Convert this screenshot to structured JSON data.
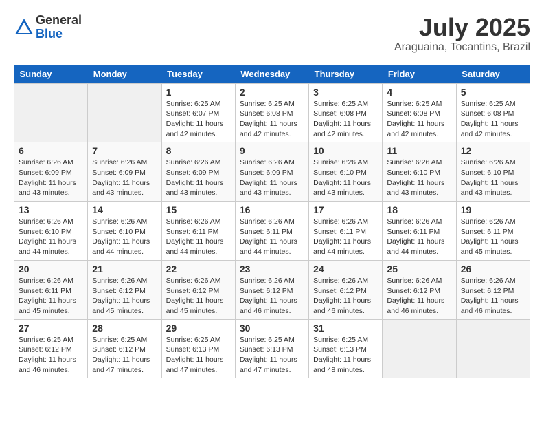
{
  "logo": {
    "general": "General",
    "blue": "Blue"
  },
  "title": {
    "month": "July 2025",
    "location": "Araguaina, Tocantins, Brazil"
  },
  "weekdays": [
    "Sunday",
    "Monday",
    "Tuesday",
    "Wednesday",
    "Thursday",
    "Friday",
    "Saturday"
  ],
  "weeks": [
    [
      {
        "day": "",
        "info": ""
      },
      {
        "day": "",
        "info": ""
      },
      {
        "day": "1",
        "info": "Sunrise: 6:25 AM\nSunset: 6:07 PM\nDaylight: 11 hours and 42 minutes."
      },
      {
        "day": "2",
        "info": "Sunrise: 6:25 AM\nSunset: 6:08 PM\nDaylight: 11 hours and 42 minutes."
      },
      {
        "day": "3",
        "info": "Sunrise: 6:25 AM\nSunset: 6:08 PM\nDaylight: 11 hours and 42 minutes."
      },
      {
        "day": "4",
        "info": "Sunrise: 6:25 AM\nSunset: 6:08 PM\nDaylight: 11 hours and 42 minutes."
      },
      {
        "day": "5",
        "info": "Sunrise: 6:25 AM\nSunset: 6:08 PM\nDaylight: 11 hours and 42 minutes."
      }
    ],
    [
      {
        "day": "6",
        "info": "Sunrise: 6:26 AM\nSunset: 6:09 PM\nDaylight: 11 hours and 43 minutes."
      },
      {
        "day": "7",
        "info": "Sunrise: 6:26 AM\nSunset: 6:09 PM\nDaylight: 11 hours and 43 minutes."
      },
      {
        "day": "8",
        "info": "Sunrise: 6:26 AM\nSunset: 6:09 PM\nDaylight: 11 hours and 43 minutes."
      },
      {
        "day": "9",
        "info": "Sunrise: 6:26 AM\nSunset: 6:09 PM\nDaylight: 11 hours and 43 minutes."
      },
      {
        "day": "10",
        "info": "Sunrise: 6:26 AM\nSunset: 6:10 PM\nDaylight: 11 hours and 43 minutes."
      },
      {
        "day": "11",
        "info": "Sunrise: 6:26 AM\nSunset: 6:10 PM\nDaylight: 11 hours and 43 minutes."
      },
      {
        "day": "12",
        "info": "Sunrise: 6:26 AM\nSunset: 6:10 PM\nDaylight: 11 hours and 43 minutes."
      }
    ],
    [
      {
        "day": "13",
        "info": "Sunrise: 6:26 AM\nSunset: 6:10 PM\nDaylight: 11 hours and 44 minutes."
      },
      {
        "day": "14",
        "info": "Sunrise: 6:26 AM\nSunset: 6:10 PM\nDaylight: 11 hours and 44 minutes."
      },
      {
        "day": "15",
        "info": "Sunrise: 6:26 AM\nSunset: 6:11 PM\nDaylight: 11 hours and 44 minutes."
      },
      {
        "day": "16",
        "info": "Sunrise: 6:26 AM\nSunset: 6:11 PM\nDaylight: 11 hours and 44 minutes."
      },
      {
        "day": "17",
        "info": "Sunrise: 6:26 AM\nSunset: 6:11 PM\nDaylight: 11 hours and 44 minutes."
      },
      {
        "day": "18",
        "info": "Sunrise: 6:26 AM\nSunset: 6:11 PM\nDaylight: 11 hours and 44 minutes."
      },
      {
        "day": "19",
        "info": "Sunrise: 6:26 AM\nSunset: 6:11 PM\nDaylight: 11 hours and 45 minutes."
      }
    ],
    [
      {
        "day": "20",
        "info": "Sunrise: 6:26 AM\nSunset: 6:11 PM\nDaylight: 11 hours and 45 minutes."
      },
      {
        "day": "21",
        "info": "Sunrise: 6:26 AM\nSunset: 6:12 PM\nDaylight: 11 hours and 45 minutes."
      },
      {
        "day": "22",
        "info": "Sunrise: 6:26 AM\nSunset: 6:12 PM\nDaylight: 11 hours and 45 minutes."
      },
      {
        "day": "23",
        "info": "Sunrise: 6:26 AM\nSunset: 6:12 PM\nDaylight: 11 hours and 46 minutes."
      },
      {
        "day": "24",
        "info": "Sunrise: 6:26 AM\nSunset: 6:12 PM\nDaylight: 11 hours and 46 minutes."
      },
      {
        "day": "25",
        "info": "Sunrise: 6:26 AM\nSunset: 6:12 PM\nDaylight: 11 hours and 46 minutes."
      },
      {
        "day": "26",
        "info": "Sunrise: 6:26 AM\nSunset: 6:12 PM\nDaylight: 11 hours and 46 minutes."
      }
    ],
    [
      {
        "day": "27",
        "info": "Sunrise: 6:25 AM\nSunset: 6:12 PM\nDaylight: 11 hours and 46 minutes."
      },
      {
        "day": "28",
        "info": "Sunrise: 6:25 AM\nSunset: 6:12 PM\nDaylight: 11 hours and 47 minutes."
      },
      {
        "day": "29",
        "info": "Sunrise: 6:25 AM\nSunset: 6:13 PM\nDaylight: 11 hours and 47 minutes."
      },
      {
        "day": "30",
        "info": "Sunrise: 6:25 AM\nSunset: 6:13 PM\nDaylight: 11 hours and 47 minutes."
      },
      {
        "day": "31",
        "info": "Sunrise: 6:25 AM\nSunset: 6:13 PM\nDaylight: 11 hours and 48 minutes."
      },
      {
        "day": "",
        "info": ""
      },
      {
        "day": "",
        "info": ""
      }
    ]
  ]
}
